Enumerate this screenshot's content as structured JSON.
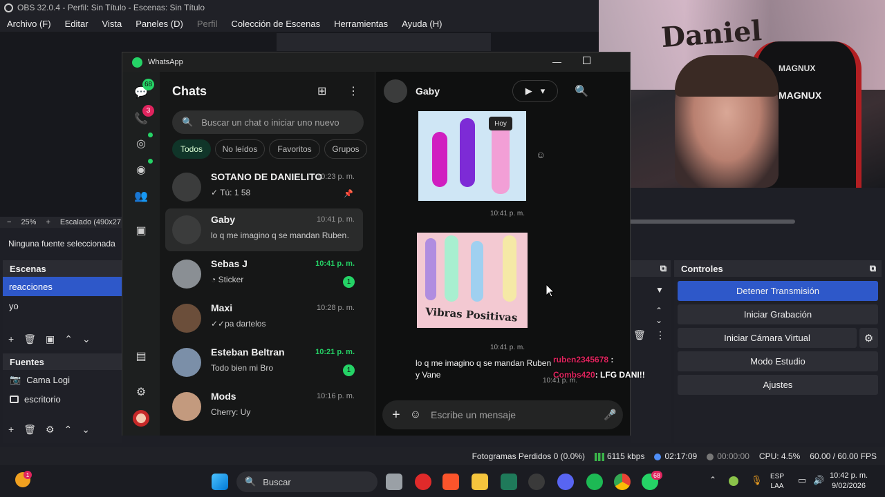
{
  "obs": {
    "title": "OBS 32.0.4 - Perfil: Sin Título - Escenas: Sin Título",
    "menu": [
      "Archivo (F)",
      "Editar",
      "Vista",
      "Paneles (D)",
      "Perfil",
      "Colección de Escenas",
      "Herramientas",
      "Ayuda (H)"
    ],
    "zoom": "25%",
    "scaling": "Escalado (490x27",
    "no_source": "Ninguna fuente seleccionada",
    "scenes_title": "Escenas",
    "scenes": [
      "reacciones",
      "yo"
    ],
    "sources_title": "Fuentes",
    "sources": [
      "Cama Logi",
      "escritorio"
    ],
    "controls_title": "Controles",
    "controls": {
      "stop_stream": "Detener Transmisión",
      "start_recording": "Iniciar Grabación",
      "start_virtual_cam": "Iniciar Cámara Virtual",
      "studio_mode": "Modo Estudio",
      "settings": "Ajustes"
    },
    "status": {
      "dropped": "Fotogramas Perdidos 0 (0.0%)",
      "bitrate": "6115 kbps",
      "stream_time": "02:17:09",
      "rec_time": "00:00:00",
      "cpu": "CPU: 4.5%",
      "fps": "60.00 / 60.00 FPS"
    },
    "cam_brand": "MAGNUX",
    "cam_wall_text": "Daniel"
  },
  "whatsapp": {
    "app_title": "WhatsApp",
    "rail_badges": {
      "chats": "68",
      "calls": "3"
    },
    "chats_title": "Chats",
    "search_placeholder": "Buscar un chat o iniciar uno nuevo",
    "filters": [
      "Todos",
      "No leídos",
      "Favoritos",
      "Grupos"
    ],
    "chats": [
      {
        "name": "SOTANO DE DANIELITO",
        "time": "10:23 p. m.",
        "preview": "✓ Tú: 1 58",
        "unread": ""
      },
      {
        "name": "Gaby",
        "time": "10:41 p. m.",
        "preview": "lo q me imagino q se mandan Ruben…",
        "unread": ""
      },
      {
        "name": "Sebas J",
        "time": "10:41 p. m.",
        "preview": "Sticker",
        "unread": "1"
      },
      {
        "name": "Maxi",
        "time": "10:28 p. m.",
        "preview": "✓✓pa dartelos",
        "unread": ""
      },
      {
        "name": "Esteban Beltran",
        "time": "10:21 p. m.",
        "preview": "Todo bien mi Bro",
        "unread": "1"
      },
      {
        "name": "Mods",
        "time": "10:16 p. m.",
        "preview": "Cherry: Uy",
        "unread": ""
      }
    ],
    "conversation": {
      "contact": "Gaby",
      "date_chip": "Hoy",
      "sticker2_caption": "Vibras Positivas",
      "time1": "10:41 p. m.",
      "time2": "10:41 p. m.",
      "message": "lo q me imagino q se mandan Ruben y Vane",
      "message_time": "10:41 p. m.",
      "composer_placeholder": "Escribe un mensaje"
    }
  },
  "stream_chat": [
    {
      "user": "ruben2345678",
      "text": ":"
    },
    {
      "user": "Combs420",
      "text": ": LFG DANI!!"
    }
  ],
  "taskbar": {
    "search": "Buscar",
    "lang1": "ESP",
    "lang2": "LAA",
    "time": "10:42 p. m.",
    "date": "9/02/2026",
    "whatsapp_badge": "68",
    "discord_badge": "",
    "firefox_badge": "1"
  }
}
